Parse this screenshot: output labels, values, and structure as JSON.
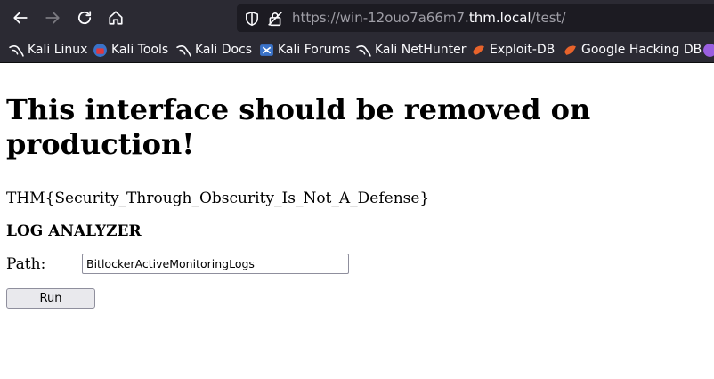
{
  "browser": {
    "url_prefix": "https://win-12ouo7a66m7.",
    "url_host": "thm.local",
    "url_suffix": "/test/",
    "bookmarks": [
      {
        "label": "Kali Linux",
        "icon": "kali-dragon-icon"
      },
      {
        "label": "Kali Tools",
        "icon": "kali-tools-icon"
      },
      {
        "label": "Kali Docs",
        "icon": "kali-dragon-icon"
      },
      {
        "label": "Kali Forums",
        "icon": "kali-forums-icon"
      },
      {
        "label": "Kali NetHunter",
        "icon": "kali-dragon-icon"
      },
      {
        "label": "Exploit-DB",
        "icon": "exploit-db-icon"
      },
      {
        "label": "Google Hacking DB",
        "icon": "exploit-db-icon"
      }
    ]
  },
  "page": {
    "heading": "This interface should be removed on production!",
    "flag": "THM{Security_Through_Obscurity_Is_Not_A_Defense}",
    "subheading": "LOG ANALYZER",
    "path_label": "Path:",
    "path_value": "BitlockerActiveMonitoringLogs",
    "run_label": "Run"
  }
}
